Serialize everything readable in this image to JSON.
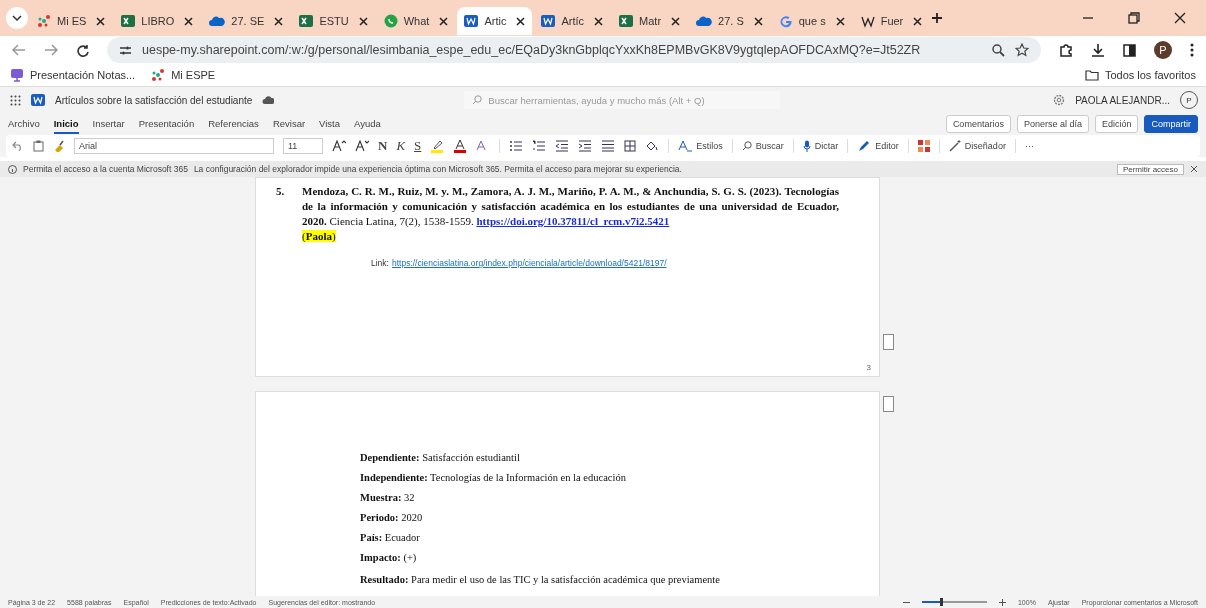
{
  "browser": {
    "tabs": [
      {
        "kind": "espe",
        "label": "Mi ES",
        "selected": false
      },
      {
        "kind": "excel",
        "label": "LIBRO",
        "selected": false
      },
      {
        "kind": "cloud",
        "label": "27. SE",
        "selected": false
      },
      {
        "kind": "excel",
        "label": "ESTU",
        "selected": false
      },
      {
        "kind": "chat",
        "label": "What",
        "selected": false
      },
      {
        "kind": "word",
        "label": "Artic",
        "selected": true
      },
      {
        "kind": "word",
        "label": "Artíc",
        "selected": false
      },
      {
        "kind": "excel",
        "label": "Matr",
        "selected": false
      },
      {
        "kind": "cloud",
        "label": "27. S",
        "selected": false
      },
      {
        "kind": "google",
        "label": "que s",
        "selected": false
      },
      {
        "kind": "wiki",
        "label": "Fuer",
        "selected": false
      }
    ],
    "url": "uespe-my.sharepoint.com/:w:/g/personal/lesimbania_espe_edu_ec/EQaDy3knGbplqcYxxKh8EPMBvGK8V9ygtqlepAOFDCAxMQ?e=Jt52ZR",
    "profile": "P",
    "bookmarks": [
      {
        "kind": "presentation",
        "label": "Presentación Notas..."
      },
      {
        "kind": "espe",
        "label": "Mi ESPE"
      }
    ],
    "all_bookmarks": "Todos los favoritos"
  },
  "word": {
    "doc_title": "Artículos sobre la satisfacción del estudiante",
    "search_placeholder": "Buscar herramientas, ayuda y mucho más (Alt + Q)",
    "user": "PAOLA ALEJANDR...",
    "user_initial": "P",
    "ribbon_tabs": [
      {
        "label": "Archivo",
        "selected": false
      },
      {
        "label": "Inicio",
        "selected": true
      },
      {
        "label": "Insertar",
        "selected": false
      },
      {
        "label": "Presentación",
        "selected": false
      },
      {
        "label": "Referencias",
        "selected": false
      },
      {
        "label": "Revisar",
        "selected": false
      },
      {
        "label": "Vista",
        "selected": false
      },
      {
        "label": "Ayuda",
        "selected": false
      }
    ],
    "actions": [
      {
        "kind": "outline",
        "label": "Comentarios"
      },
      {
        "kind": "outline",
        "label": "Ponerse al día"
      },
      {
        "kind": "outline",
        "label": "Edición"
      },
      {
        "kind": "primary",
        "label": "Compartir"
      }
    ],
    "toolbar": {
      "font": "Arial",
      "size": "11",
      "format": [
        "N",
        "K",
        "S"
      ],
      "commands": [
        "Estilos",
        "Buscar",
        "Dictar",
        "Editor",
        "Diseñador"
      ],
      "more": "···"
    },
    "infobar": {
      "title": "Permita el acceso a la cuenta Microsoft 365",
      "message": "La configuración del explorador impide una experiencia óptima con Microsoft 365. Permita el acceso para mejorar su experiencia.",
      "button": "Permitir acceso"
    },
    "page1": {
      "reference": {
        "number": "5.",
        "text": "**Mendoza, C. R. M., Ruiz, M. y. M., Zamora, A. J. M., Mariño, P. A. M., & Anchundia, S. G. S. (2023). Tecnologías de la información y comunicación y satisfacción académica en los estudiantes de una universidad de Ecuador, 2020.** Ciencia Latina, 7(2), 1538-1559.",
        "link": "https://doi.org/10.37811/cl_rcm.v7i2.5421",
        "note": "(**Paola**)",
        "highlighted": true
      },
      "link_label": "Link:",
      "link": "https://cienciaslatina.org/index.php/cienciala/article/download/5421/8197/",
      "page_number": "3"
    },
    "page2": {
      "fields": [
        {
          "label": "Dependiente:",
          "value": "Satisfacción estudiantil"
        },
        {
          "label": "Independiente:",
          "value": "Tecnologías de la Información en la educación"
        },
        {
          "label": "Muestra:",
          "value": "32"
        },
        {
          "label": "Periodo:",
          "value": "2020"
        },
        {
          "label": "País:",
          "value": "Ecuador"
        },
        {
          "label": "Impacto:",
          "value": "(+)"
        }
      ],
      "result_label": "Resultado:",
      "result": "Para medir el uso de las TIC y la satisfacción académica que previamente"
    },
    "status": {
      "items": [
        "Página 3 de 22",
        "5588 palabras",
        "Español",
        "Predicciones de texto:Activado",
        "Sugerencias del editor: mostrando"
      ],
      "zoom_slider": {
        "level": 0.3
      },
      "zoom": "100%",
      "fit": "Ajustar",
      "feedback": "Proporcionar comentarios a Microsoft"
    }
  }
}
